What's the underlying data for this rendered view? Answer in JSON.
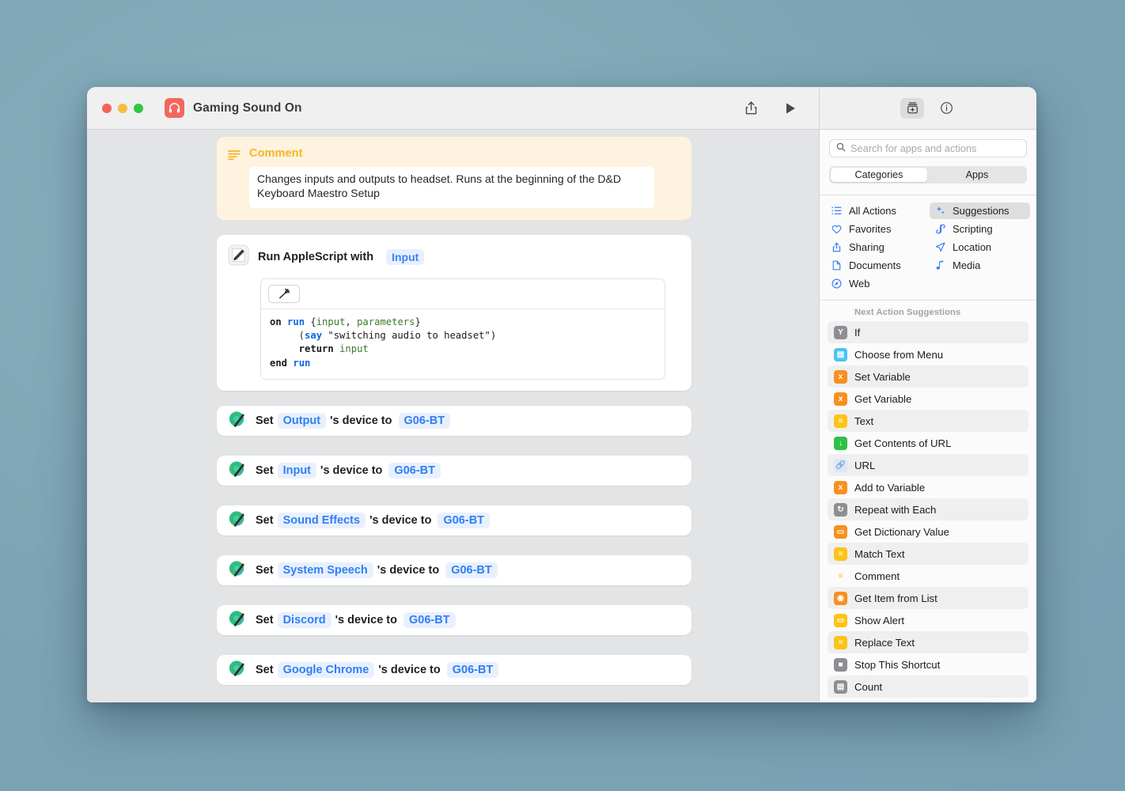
{
  "window": {
    "title": "Gaming Sound On",
    "app_icon": "headphones-icon",
    "traffic_lights": [
      "close",
      "minimize",
      "zoom"
    ]
  },
  "toolbar": {
    "share_icon": "share-icon",
    "run_icon": "play-icon",
    "library_icon": "action-library-icon",
    "info_icon": "info-icon"
  },
  "editor": {
    "comment": {
      "icon": "comment-lines-icon",
      "title": "Comment",
      "text": "Changes inputs and outputs to headset. Runs at the beginning of the D&D Keyboard Maestro Setup"
    },
    "applescript": {
      "icon": "script-editor-icon",
      "title": "Run AppleScript with",
      "input_token": "Input",
      "toolbar_icon": "hammer-icon",
      "code_lines": [
        {
          "parts": [
            {
              "t": "on ",
              "c": "kw"
            },
            {
              "t": "run ",
              "c": "blue"
            },
            {
              "t": "{",
              "c": "pun"
            },
            {
              "t": "input",
              "c": "grn"
            },
            {
              "t": ", ",
              "c": "pun"
            },
            {
              "t": "parameters",
              "c": "grn"
            },
            {
              "t": "}",
              "c": "pun"
            }
          ]
        },
        {
          "parts": [
            {
              "t": "     (",
              "c": "pun"
            },
            {
              "t": "say",
              "c": "blue"
            },
            {
              "t": " \"switching audio to headset\")",
              "c": "str"
            }
          ]
        },
        {
          "parts": [
            {
              "t": "     return ",
              "c": "kw"
            },
            {
              "t": "input",
              "c": "grn"
            }
          ]
        },
        {
          "parts": [
            {
              "t": "end ",
              "c": "kw"
            },
            {
              "t": "run",
              "c": "blue"
            }
          ]
        }
      ]
    },
    "set_actions": [
      {
        "icon": "audio-device-icon",
        "verb": "Set",
        "target": "Output",
        "middle": "'s device to",
        "device": "G06-BT"
      },
      {
        "icon": "audio-device-icon",
        "verb": "Set",
        "target": "Input",
        "middle": "'s device to",
        "device": "G06-BT"
      },
      {
        "icon": "audio-device-icon",
        "verb": "Set",
        "target": "Sound Effects",
        "middle": "'s device to",
        "device": "G06-BT"
      },
      {
        "icon": "audio-device-icon",
        "verb": "Set",
        "target": "System Speech",
        "middle": "'s device to",
        "device": "G06-BT"
      },
      {
        "icon": "audio-device-icon",
        "verb": "Set",
        "target": "Discord",
        "middle": "'s device to",
        "device": "G06-BT"
      },
      {
        "icon": "audio-device-icon",
        "verb": "Set",
        "target": "Google Chrome",
        "middle": "'s device to",
        "device": "G06-BT"
      }
    ]
  },
  "library": {
    "search": {
      "icon": "search-icon",
      "placeholder": "Search for apps and actions",
      "value": ""
    },
    "segmented": {
      "options": [
        "Categories",
        "Apps"
      ],
      "selected": "Categories"
    },
    "categories": [
      {
        "label": "All Actions",
        "icon": "list-icon",
        "selected": false
      },
      {
        "label": "Suggestions",
        "icon": "sparkles-icon",
        "selected": true
      },
      {
        "label": "Favorites",
        "icon": "heart-icon",
        "selected": false
      },
      {
        "label": "Scripting",
        "icon": "scroll-icon",
        "selected": false
      },
      {
        "label": "Sharing",
        "icon": "share-icon",
        "selected": false
      },
      {
        "label": "Location",
        "icon": "navigation-icon",
        "selected": false
      },
      {
        "label": "Documents",
        "icon": "document-icon",
        "selected": false
      },
      {
        "label": "Media",
        "icon": "music-note-icon",
        "selected": false
      },
      {
        "label": "Web",
        "icon": "compass-icon",
        "selected": false
      }
    ],
    "suggestions_header": "Next Action Suggestions",
    "suggestions": [
      {
        "label": "If",
        "icon": "if-icon",
        "color": "#8e8e93",
        "glyph": "Y"
      },
      {
        "label": "Choose from Menu",
        "icon": "menu-icon",
        "color": "#4cc3f5",
        "glyph": "▤"
      },
      {
        "label": "Set Variable",
        "icon": "variable-icon",
        "color": "#f7901e",
        "glyph": "x"
      },
      {
        "label": "Get Variable",
        "icon": "variable-icon",
        "color": "#f7901e",
        "glyph": "x"
      },
      {
        "label": "Text",
        "icon": "text-icon",
        "color": "#fcc417",
        "glyph": "≡"
      },
      {
        "label": "Get Contents of URL",
        "icon": "download-icon",
        "color": "#2fc04a",
        "glyph": "↓"
      },
      {
        "label": "URL",
        "icon": "link-icon",
        "color": "#dbe7fb",
        "glyph": "🔗"
      },
      {
        "label": "Add to Variable",
        "icon": "variable-icon",
        "color": "#f7901e",
        "glyph": "x"
      },
      {
        "label": "Repeat with Each",
        "icon": "repeat-icon",
        "color": "#8e8e93",
        "glyph": "↻"
      },
      {
        "label": "Get Dictionary Value",
        "icon": "dictionary-icon",
        "color": "#f7901e",
        "glyph": "▭"
      },
      {
        "label": "Match Text",
        "icon": "text-icon",
        "color": "#fcc417",
        "glyph": "≡"
      },
      {
        "label": "Comment",
        "icon": "comment-lines-icon",
        "color": "transparent",
        "glyph": "≡"
      },
      {
        "label": "Get Item from List",
        "icon": "list-item-icon",
        "color": "#f7901e",
        "glyph": "◉"
      },
      {
        "label": "Show Alert",
        "icon": "alert-icon",
        "color": "#fcc417",
        "glyph": "▭"
      },
      {
        "label": "Replace Text",
        "icon": "text-icon",
        "color": "#fcc417",
        "glyph": "≡"
      },
      {
        "label": "Stop This Shortcut",
        "icon": "stop-icon",
        "color": "#8e8e93",
        "glyph": "■"
      },
      {
        "label": "Count",
        "icon": "count-icon",
        "color": "#8e8e93",
        "glyph": "▤"
      }
    ]
  },
  "colors": {
    "desktop": "#7da3b4",
    "canvas": "#e3e4e6",
    "comment_bg": "#fdf3df",
    "comment_accent": "#f8b521",
    "token_blue": "#3b82f6",
    "app_icon": "#f4675f"
  }
}
